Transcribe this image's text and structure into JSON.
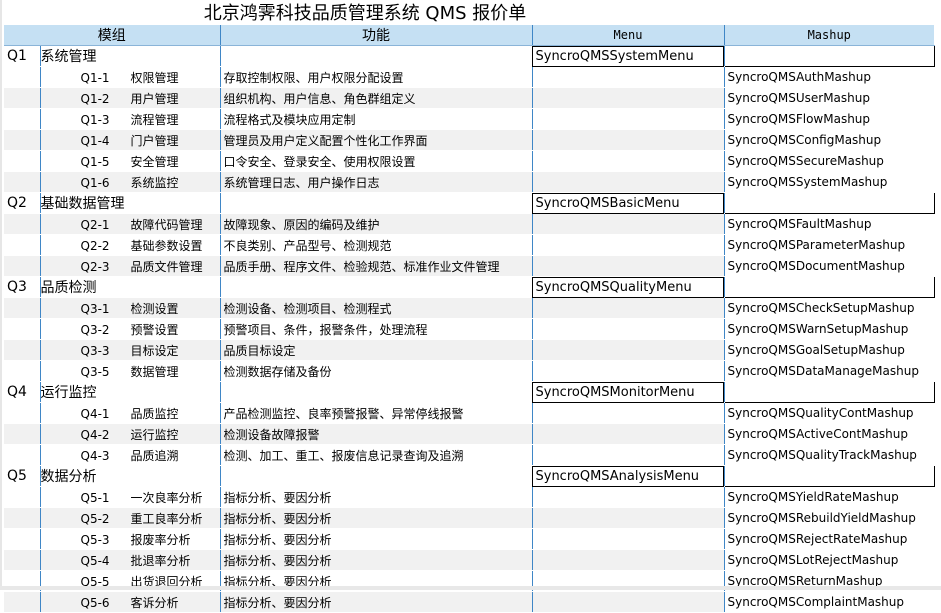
{
  "title": "北京鸿霁科技品质管理系统 QMS 报价单",
  "headers": {
    "module": "模组",
    "feature": "功能",
    "menu": "Menu",
    "mashup": "Mashup"
  },
  "sections": [
    {
      "code": "Q1",
      "name": "系统管理",
      "menu": "SyncroQMSSystemMenu",
      "items": [
        {
          "code": "Q1-1",
          "name": "权限管理",
          "desc": "存取控制权限、用户权限分配设置",
          "mashup": "SyncroQMSAuthMashup"
        },
        {
          "code": "Q1-2",
          "name": "用户管理",
          "desc": "组织机构、用户信息、角色群组定义",
          "mashup": "SyncroQMSUserMashup"
        },
        {
          "code": "Q1-3",
          "name": "流程管理",
          "desc": "流程格式及模块应用定制",
          "mashup": "SyncroQMSFlowMashup"
        },
        {
          "code": "Q1-4",
          "name": "门户管理",
          "desc": "管理员及用户定义配置个性化工作界面",
          "mashup": "SyncroQMSConfigMashup"
        },
        {
          "code": "Q1-5",
          "name": "安全管理",
          "desc": "口令安全、登录安全、使用权限设置",
          "mashup": "SyncroQMSSecureMashup"
        },
        {
          "code": "Q1-6",
          "name": "系统监控",
          "desc": "系统管理日志、用户操作日志",
          "mashup": "SyncroQMSSystemMashup"
        }
      ]
    },
    {
      "code": "Q2",
      "name": "基础数据管理",
      "menu": "SyncroQMSBasicMenu",
      "items": [
        {
          "code": "Q2-1",
          "name": "故障代码管理",
          "desc": "故障现象、原因的编码及维护",
          "mashup": "SyncroQMSFaultMashup"
        },
        {
          "code": "Q2-2",
          "name": "基础参数设置",
          "desc": "不良类别、产品型号、检测规范",
          "mashup": "SyncroQMSParameterMashup"
        },
        {
          "code": "Q2-3",
          "name": "品质文件管理",
          "desc": "品质手册、程序文件、检验规范、标准作业文件管理",
          "mashup": "SyncroQMSDocumentMashup"
        }
      ]
    },
    {
      "code": "Q3",
      "name": "品质检测",
      "menu": "SyncroQMSQualityMenu",
      "items": [
        {
          "code": "Q3-1",
          "name": "检测设置",
          "desc": "检测设备、检测项目、检测程式",
          "mashup": "SyncroQMSCheckSetupMashup"
        },
        {
          "code": "Q3-2",
          "name": "预警设置",
          "desc": "预警项目、条件，报警条件，处理流程",
          "mashup": "SyncroQMSWarnSetupMashup"
        },
        {
          "code": "Q3-3",
          "name": "目标设定",
          "desc": "品质目标设定",
          "mashup": "SyncroQMSGoalSetupMashup"
        },
        {
          "code": "Q3-5",
          "name": "数据管理",
          "desc": "检测数据存储及备份",
          "mashup": "SyncroQMSDataManageMashup"
        }
      ]
    },
    {
      "code": "Q4",
      "name": "运行监控",
      "menu": "SyncroQMSMonitorMenu",
      "items": [
        {
          "code": "Q4-1",
          "name": "品质监控",
          "desc": "产品检测监控、良率预警报警、异常停线报警",
          "mashup": "SyncroQMSQualityContMashup"
        },
        {
          "code": "Q4-2",
          "name": "运行监控",
          "desc": "检测设备故障报警",
          "mashup": "SyncroQMSActiveContMashup"
        },
        {
          "code": "Q4-3",
          "name": "品质追溯",
          "desc": "检测、加工、重工、报废信息记录查询及追溯",
          "mashup": "SyncroQMSQualityTrackMashup"
        }
      ]
    },
    {
      "code": "Q5",
      "name": "数据分析",
      "menu": "SyncroQMSAnalysisMenu",
      "items": [
        {
          "code": "Q5-1",
          "name": "一次良率分析",
          "desc": "指标分析、要因分析",
          "mashup": "SyncroQMSYieldRateMashup"
        },
        {
          "code": "Q5-2",
          "name": "重工良率分析",
          "desc": "指标分析、要因分析",
          "mashup": "SyncroQMSRebuildYieldMashup"
        },
        {
          "code": "Q5-3",
          "name": "报废率分析",
          "desc": "指标分析、要因分析",
          "mashup": "SyncroQMSRejectRateMashup"
        },
        {
          "code": "Q5-4",
          "name": "批退率分析",
          "desc": "指标分析、要因分析",
          "mashup": "SyncroQMSLotRejectMashup"
        },
        {
          "code": "Q5-5",
          "name": "出货退回分析",
          "desc": "指标分析、要因分析",
          "mashup": "SyncroQMSReturnMashup"
        },
        {
          "code": "Q5-6",
          "name": "客诉分析",
          "desc": "指标分析、要因分析",
          "mashup": "SyncroQMSComplaintMashup"
        }
      ]
    }
  ]
}
